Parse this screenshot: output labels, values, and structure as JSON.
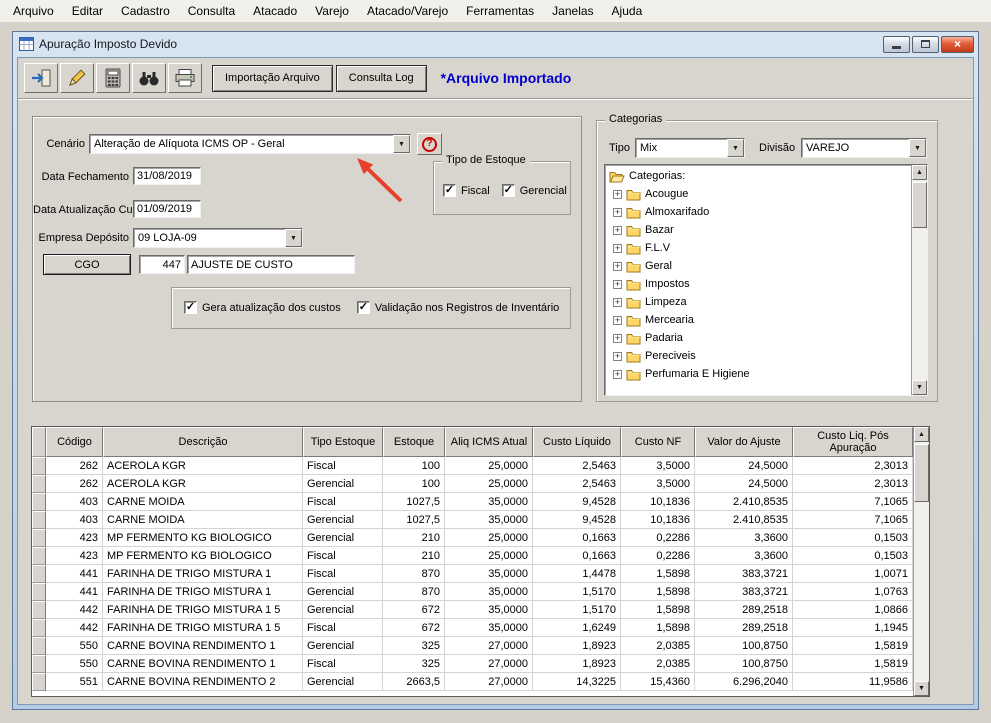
{
  "icons": {
    "combo_arrow": "▼",
    "scroll_up": "▲",
    "scroll_down": "▼",
    "check": "✓",
    "tree_expand": "+",
    "help_glyph": "?",
    "close_glyph": "×"
  },
  "colors": {
    "status_text": "#0000cc",
    "annotation_arrow": "#e8402a",
    "help_icon": "#cc0000",
    "titlebar_gradient": [
      "#d7e5f2",
      "#b3cbe4"
    ]
  },
  "menubar": {
    "items": [
      "Arquivo",
      "Editar",
      "Cadastro",
      "Consulta",
      "Atacado",
      "Varejo",
      "Atacado/Varejo",
      "Ferramentas",
      "Janelas",
      "Ajuda"
    ]
  },
  "window": {
    "title": "Apuração Imposto Devido"
  },
  "toolbar": {
    "import_button": "Importação Arquivo",
    "log_button": "Consulta Log",
    "status": "*Arquivo Importado"
  },
  "form": {
    "cenario": {
      "label": "Cenário",
      "value": "Alteração de Alíquota ICMS OP - Geral"
    },
    "data_fechamento": {
      "label": "Data Fechamento",
      "value": "31/08/2019"
    },
    "data_atualizacao": {
      "label": "Data Atualização Custo",
      "value": "01/09/2019"
    },
    "empresa_deposito": {
      "label": "Empresa Depósito",
      "value": "09 LOJA-09"
    },
    "cgo": {
      "button": "CGO",
      "code": "447",
      "descricao": "AJUSTE DE CUSTO"
    },
    "tipo_estoque": {
      "legend": "Tipo de Estoque",
      "options": [
        {
          "label": "Fiscal",
          "checked": true
        },
        {
          "label": "Gerencial",
          "checked": true
        }
      ]
    },
    "flags": [
      {
        "label": "Gera atualização dos custos",
        "checked": true
      },
      {
        "label": "Validação nos Registros de Inventário",
        "checked": true
      }
    ]
  },
  "categorias": {
    "legend": "Categorias",
    "tipo": {
      "label": "Tipo",
      "value": "Mix"
    },
    "divisao": {
      "label": "Divisão",
      "value": "VAREJO"
    },
    "tree": {
      "root": "Categorias:",
      "items": [
        "Acougue",
        "Almoxarifado",
        "Bazar",
        "F.L.V",
        "Geral",
        "Impostos",
        "Limpeza",
        "Mercearia",
        "Padaria",
        "Pereciveis",
        "Perfumaria E Higiene"
      ]
    }
  },
  "grid": {
    "columns": [
      "Código",
      "Descrição",
      "Tipo Estoque",
      "Estoque",
      "Aliq ICMS Atual",
      "Custo Líquido",
      "Custo NF",
      "Valor do Ajuste",
      "Custo Liq. Pós Apuração"
    ],
    "rows": [
      [
        "262",
        "ACEROLA KGR",
        "Fiscal",
        "100",
        "25,0000",
        "2,5463",
        "3,5000",
        "24,5000",
        "2,3013"
      ],
      [
        "262",
        "ACEROLA KGR",
        "Gerencial",
        "100",
        "25,0000",
        "2,5463",
        "3,5000",
        "24,5000",
        "2,3013"
      ],
      [
        "403",
        "CARNE MOIDA",
        "Fiscal",
        "1027,5",
        "35,0000",
        "9,4528",
        "10,1836",
        "2.410,8535",
        "7,1065"
      ],
      [
        "403",
        "CARNE MOIDA",
        "Gerencial",
        "1027,5",
        "35,0000",
        "9,4528",
        "10,1836",
        "2.410,8535",
        "7,1065"
      ],
      [
        "423",
        "MP FERMENTO KG BIOLOGICO",
        "Gerencial",
        "210",
        "25,0000",
        "0,1663",
        "0,2286",
        "3,3600",
        "0,1503"
      ],
      [
        "423",
        "MP FERMENTO KG BIOLOGICO",
        "Fiscal",
        "210",
        "25,0000",
        "0,1663",
        "0,2286",
        "3,3600",
        "0,1503"
      ],
      [
        "441",
        "FARINHA DE TRIGO MISTURA 1",
        "Fiscal",
        "870",
        "35,0000",
        "1,4478",
        "1,5898",
        "383,3721",
        "1,0071"
      ],
      [
        "441",
        "FARINHA DE TRIGO MISTURA 1",
        "Gerencial",
        "870",
        "35,0000",
        "1,5170",
        "1,5898",
        "383,3721",
        "1,0763"
      ],
      [
        "442",
        "FARINHA DE TRIGO MISTURA 1 5",
        "Gerencial",
        "672",
        "35,0000",
        "1,5170",
        "1,5898",
        "289,2518",
        "1,0866"
      ],
      [
        "442",
        "FARINHA DE TRIGO MISTURA 1 5",
        "Fiscal",
        "672",
        "35,0000",
        "1,6249",
        "1,5898",
        "289,2518",
        "1,1945"
      ],
      [
        "550",
        "CARNE BOVINA RENDIMENTO 1",
        "Gerencial",
        "325",
        "27,0000",
        "1,8923",
        "2,0385",
        "100,8750",
        "1,5819"
      ],
      [
        "550",
        "CARNE BOVINA RENDIMENTO 1",
        "Fiscal",
        "325",
        "27,0000",
        "1,8923",
        "2,0385",
        "100,8750",
        "1,5819"
      ],
      [
        "551",
        "CARNE BOVINA RENDIMENTO 2",
        "Gerencial",
        "2663,5",
        "27,0000",
        "14,3225",
        "15,4360",
        "6.296,2040",
        "11,9586"
      ]
    ]
  }
}
